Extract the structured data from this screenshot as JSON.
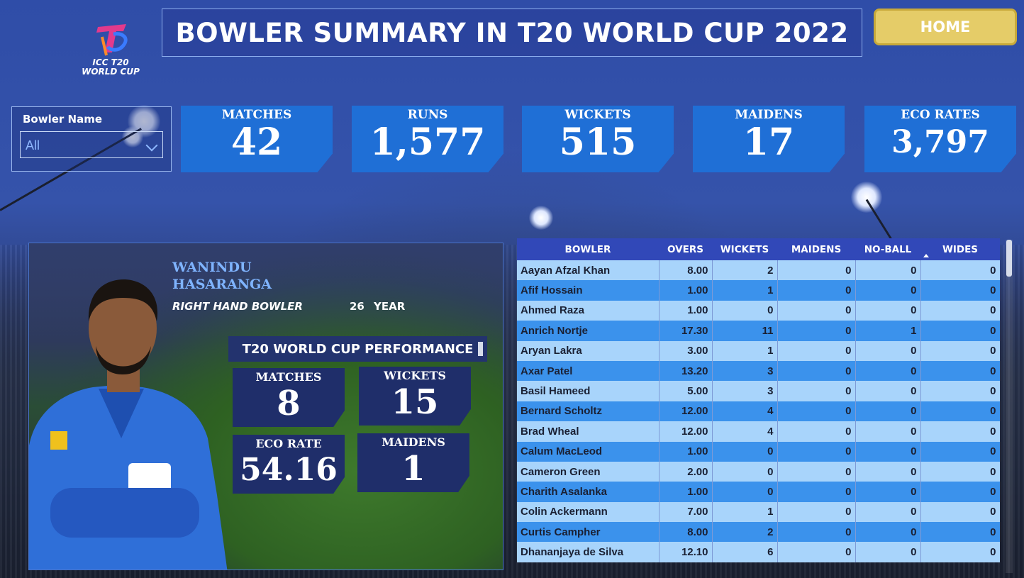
{
  "header": {
    "title": "BOWLER SUMMARY IN T20 WORLD CUP 2022",
    "home_label": "HOME",
    "logo_text_line1": "ICC T20",
    "logo_text_line2": "WORLD CUP"
  },
  "slicer": {
    "label": "Bowler Name",
    "value": "All"
  },
  "kpis": [
    {
      "label": "MATCHES",
      "value": "42"
    },
    {
      "label": "RUNS",
      "value": "1,577"
    },
    {
      "label": "WICKETS",
      "value": "515"
    },
    {
      "label": "MAIDENS",
      "value": "17"
    },
    {
      "label": "ECO RATES",
      "value": "3,797"
    }
  ],
  "player": {
    "name_line1": "WANINDU",
    "name_line2": "HASARANGA",
    "role": "RIGHT HAND BOWLER",
    "age": "26",
    "age_unit": "YEAR",
    "performance_title": "T20 WORLD CUP PERFORMANCE",
    "stats": {
      "matches_label": "MATCHES",
      "matches": "8",
      "wickets_label": "WICKETS",
      "wickets": "15",
      "eco_label": "ECO RATE",
      "eco": "54.16",
      "maidens_label": "MAIDENS",
      "maidens": "1"
    }
  },
  "table": {
    "columns": [
      "BOWLER",
      "OVERS",
      "WICKETS",
      "MAIDENS",
      "NO-BALL",
      "WIDES"
    ],
    "rows": [
      [
        "Aayan Afzal Khan",
        "8.00",
        "2",
        "0",
        "0",
        "0"
      ],
      [
        "Afif Hossain",
        "1.00",
        "1",
        "0",
        "0",
        "0"
      ],
      [
        "Ahmed Raza",
        "1.00",
        "0",
        "0",
        "0",
        "0"
      ],
      [
        "Anrich Nortje",
        "17.30",
        "11",
        "0",
        "1",
        "0"
      ],
      [
        "Aryan Lakra",
        "3.00",
        "1",
        "0",
        "0",
        "0"
      ],
      [
        "Axar Patel",
        "13.20",
        "3",
        "0",
        "0",
        "0"
      ],
      [
        "Basil Hameed",
        "5.00",
        "3",
        "0",
        "0",
        "0"
      ],
      [
        "Bernard Scholtz",
        "12.00",
        "4",
        "0",
        "0",
        "0"
      ],
      [
        "Brad Wheal",
        "12.00",
        "4",
        "0",
        "0",
        "0"
      ],
      [
        "Calum MacLeod",
        "1.00",
        "0",
        "0",
        "0",
        "0"
      ],
      [
        "Cameron Green",
        "2.00",
        "0",
        "0",
        "0",
        "0"
      ],
      [
        "Charith Asalanka",
        "1.00",
        "0",
        "0",
        "0",
        "0"
      ],
      [
        "Colin Ackermann",
        "7.00",
        "1",
        "0",
        "0",
        "0"
      ],
      [
        "Curtis Campher",
        "8.00",
        "2",
        "0",
        "0",
        "0"
      ],
      [
        "Dhananjaya de Silva",
        "12.10",
        "6",
        "0",
        "0",
        "0"
      ]
    ]
  },
  "colors": {
    "kpi_blue": "#1f6fd6",
    "home_gold": "#e5cc68",
    "header_blue": "#3148b8",
    "row_light": "#a8d4fb",
    "row_dark": "#3b92ec"
  }
}
